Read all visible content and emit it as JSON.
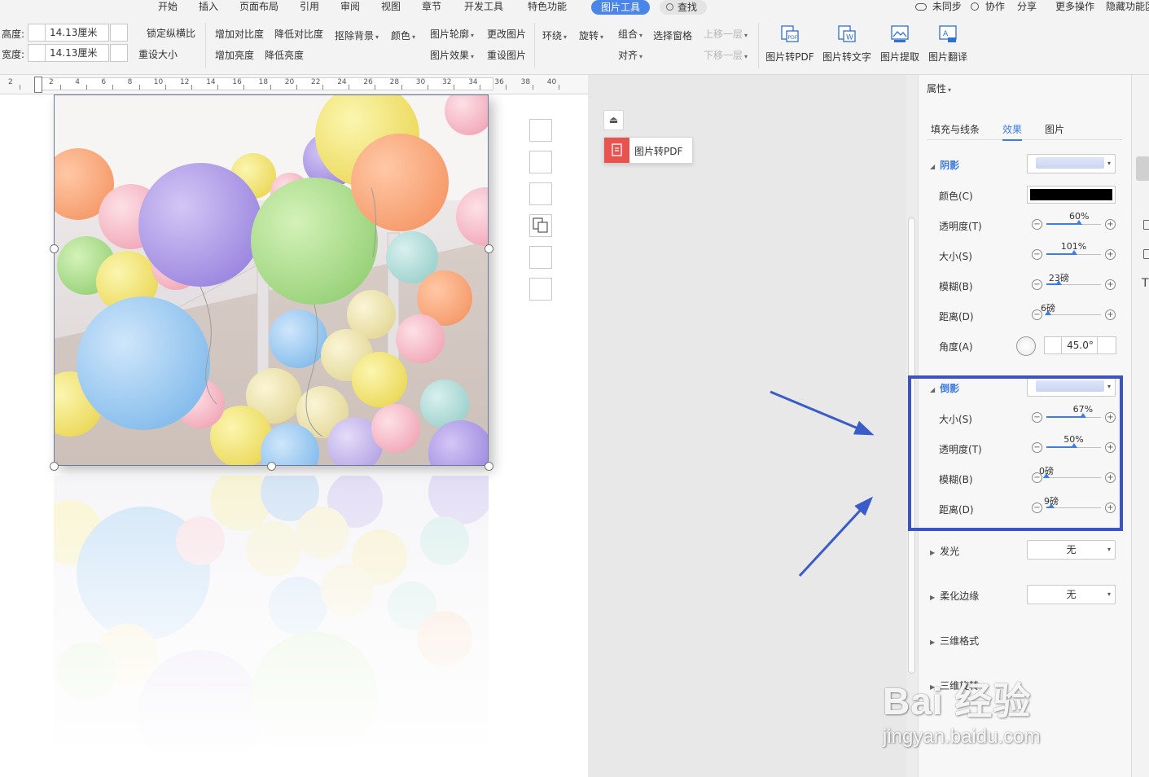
{
  "menu": {
    "items": [
      "开始",
      "插入",
      "页面布局",
      "引用",
      "审阅",
      "视图",
      "章节",
      "开发工具",
      "特色功能"
    ],
    "active_tab": "图片工具",
    "search": "查找",
    "sync": "未同步",
    "collab": "协作",
    "share": "分享",
    "more": "更多操作",
    "hide": "隐藏功能区"
  },
  "toolbar": {
    "height_label": "高度:",
    "height_value": "14.13厘米",
    "width_label": "宽度:",
    "width_value": "14.13厘米",
    "lock_ratio": "锁定纵横比",
    "reset_size": "重设大小",
    "increase_contrast": "增加对比度",
    "decrease_contrast": "降低对比度",
    "increase_brightness": "增加亮度",
    "decrease_brightness": "降低亮度",
    "remove_bg": "抠除背景",
    "color": "颜色",
    "picture_outline": "图片轮廓",
    "picture_effects": "图片效果",
    "change_picture": "更改图片",
    "reset_picture": "重设图片",
    "wrap": "环绕",
    "rotate": "旋转",
    "group": "组合",
    "align": "对齐",
    "selection_pane": "选择窗格",
    "bring_forward": "上移一层",
    "send_backward": "下移一层",
    "to_pdf": "图片转PDF",
    "to_text": "图片转文字",
    "extract": "图片提取",
    "translate": "图片翻译"
  },
  "ruler": {
    "ticks": [
      "2",
      "2",
      "4",
      "6",
      "8",
      "10",
      "12",
      "14",
      "16",
      "18",
      "20",
      "22",
      "24",
      "26",
      "28",
      "30",
      "32",
      "34",
      "36",
      "38",
      "40"
    ]
  },
  "float_panel": {
    "pdf_label": "图片转PDF"
  },
  "panel": {
    "title": "属性",
    "tabs": [
      "填充与线条",
      "效果",
      "图片"
    ],
    "active_tab": "效果",
    "shadow": {
      "header": "阴影",
      "color_label": "颜色(C)",
      "color_value": "#000000",
      "transparency_label": "透明度(T)",
      "transparency_value": "60%",
      "transparency_level": 0.6,
      "size_label": "大小(S)",
      "size_value": "101%",
      "size_level": 0.5,
      "blur_label": "模糊(B)",
      "blur_value": "23磅",
      "blur_level": 0.23,
      "distance_label": "距离(D)",
      "distance_value": "6磅",
      "distance_level": 0.03,
      "angle_label": "角度(A)",
      "angle_value": "45.0°"
    },
    "reflection": {
      "header": "倒影",
      "size_label": "大小(S)",
      "size_value": "67%",
      "size_level": 0.67,
      "transparency_label": "透明度(T)",
      "transparency_value": "50%",
      "transparency_level": 0.5,
      "blur_label": "模糊(B)",
      "blur_value": "0磅",
      "blur_level": 0.0,
      "distance_label": "距离(D)",
      "distance_value": "9磅",
      "distance_level": 0.09
    },
    "glow": {
      "header": "发光",
      "value": "无"
    },
    "soft_edges": {
      "header": "柔化边缘",
      "value": "无"
    },
    "format_3d": {
      "header": "三维格式"
    },
    "rotation_3d": {
      "header": "三维旋转"
    }
  },
  "watermark": {
    "main": "Bai 经验",
    "sub": "jingyan.baidu.com"
  },
  "colors": {
    "accent": "#3e7de5",
    "highlight_box": "#3a54c4",
    "arrow": "#3a5cc9"
  }
}
